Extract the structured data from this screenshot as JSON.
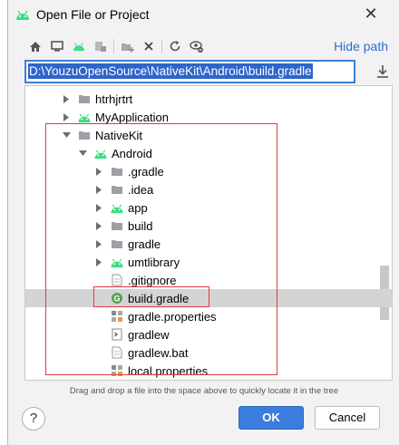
{
  "dialog": {
    "title": "Open File or Project",
    "close_symbol": "✕"
  },
  "toolbar": {
    "buttons": [
      {
        "name": "home-icon"
      },
      {
        "name": "desktop-icon"
      },
      {
        "name": "project-icon"
      },
      {
        "name": "module-icon"
      },
      {
        "name": "new-folder-icon"
      },
      {
        "name": "delete-icon"
      },
      {
        "name": "refresh-icon"
      },
      {
        "name": "show-hidden-icon"
      }
    ],
    "hide_path_label": "Hide path"
  },
  "path": {
    "value": "D:\\YouzuOpenSource\\NativeKit\\Android\\build.gradle"
  },
  "tree": {
    "rows": [
      {
        "label": "htrhjrtrt",
        "depth": 0,
        "expanded": false,
        "icon": "folder",
        "selected": false
      },
      {
        "label": "MyApplication",
        "depth": 0,
        "expanded": false,
        "icon": "android-module",
        "selected": false
      },
      {
        "label": "NativeKit",
        "depth": 0,
        "expanded": true,
        "icon": "folder",
        "selected": false
      },
      {
        "label": "Android",
        "depth": 1,
        "expanded": true,
        "icon": "android-module",
        "selected": false
      },
      {
        "label": ".gradle",
        "depth": 2,
        "expanded": false,
        "icon": "folder",
        "selected": false
      },
      {
        "label": ".idea",
        "depth": 2,
        "expanded": false,
        "icon": "folder",
        "selected": false
      },
      {
        "label": "app",
        "depth": 2,
        "expanded": false,
        "icon": "android-module",
        "selected": false
      },
      {
        "label": "build",
        "depth": 2,
        "expanded": false,
        "icon": "folder",
        "selected": false
      },
      {
        "label": "gradle",
        "depth": 2,
        "expanded": false,
        "icon": "folder",
        "selected": false
      },
      {
        "label": "umtlibrary",
        "depth": 2,
        "expanded": false,
        "icon": "android-module",
        "selected": false
      },
      {
        "label": ".gitignore",
        "depth": 2,
        "expanded": null,
        "icon": "text-file",
        "selected": false
      },
      {
        "label": "build.gradle",
        "depth": 2,
        "expanded": null,
        "icon": "gradle-file",
        "selected": true
      },
      {
        "label": "gradle.properties",
        "depth": 2,
        "expanded": null,
        "icon": "properties-file",
        "selected": false
      },
      {
        "label": "gradlew",
        "depth": 2,
        "expanded": null,
        "icon": "script-file",
        "selected": false
      },
      {
        "label": "gradlew.bat",
        "depth": 2,
        "expanded": null,
        "icon": "text-file",
        "selected": false
      },
      {
        "label": "local.properties",
        "depth": 2,
        "expanded": null,
        "icon": "properties-file",
        "selected": false
      }
    ]
  },
  "hint": "Drag and drop a file into the space above to quickly locate it in the tree",
  "buttons": {
    "help": "?",
    "ok": "OK",
    "cancel": "Cancel"
  },
  "colors": {
    "accent": "#3b7ddd",
    "android_green": "#3ddc84",
    "highlight_red": "#e03b3b",
    "selection": "#2f65ca"
  }
}
